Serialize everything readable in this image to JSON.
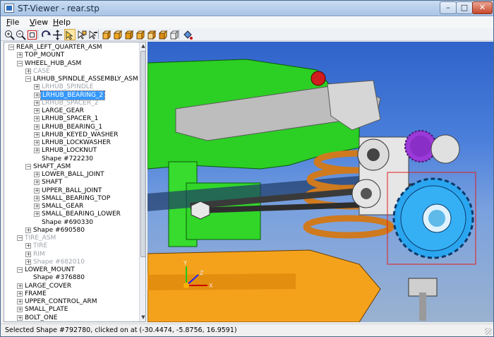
{
  "window": {
    "title": "ST-Viewer - rear.stp"
  },
  "menu": [
    {
      "label": "File",
      "key": "F",
      "rest": "ile"
    },
    {
      "label": "View",
      "key": "V",
      "rest": "iew"
    },
    {
      "label": "Help",
      "key": "H",
      "rest": "elp"
    }
  ],
  "toolbar": [
    {
      "name": "zoom-in-button",
      "icon": "zoom-in-icon"
    },
    {
      "name": "zoom-out-button",
      "icon": "zoom-out-icon"
    },
    {
      "name": "zoom-fit-button",
      "icon": "zoom-fit-icon"
    },
    {
      "name": "rotate-button",
      "icon": "rotate-icon"
    },
    {
      "name": "pan-button",
      "icon": "pan-icon"
    },
    {
      "name": "select-shape-button",
      "icon": "select-shape-icon",
      "active": true
    },
    {
      "name": "pick-face-button",
      "icon": "pick-face-icon"
    },
    {
      "name": "pick-edge-button",
      "icon": "pick-edge-icon"
    },
    {
      "name": "view-front-button",
      "icon": "cube-front-icon"
    },
    {
      "name": "view-back-button",
      "icon": "cube-back-icon"
    },
    {
      "name": "view-top-button",
      "icon": "cube-top-icon"
    },
    {
      "name": "view-bottom-button",
      "icon": "cube-bottom-icon"
    },
    {
      "name": "view-left-button",
      "icon": "cube-left-icon"
    },
    {
      "name": "view-right-button",
      "icon": "cube-right-icon"
    },
    {
      "name": "view-iso-button",
      "icon": "cube-iso-icon"
    },
    {
      "name": "shading-button",
      "icon": "paint-bucket-icon"
    }
  ],
  "tree": {
    "nodes": [
      {
        "label": "REAR_LEFT_QUARTER_ASM",
        "level": 0,
        "toggle": "-"
      },
      {
        "label": "TOP_MOUNT",
        "level": 1,
        "toggle": "+"
      },
      {
        "label": "WHEEL_HUB_ASM",
        "level": 1,
        "toggle": "-"
      },
      {
        "label": "CASE",
        "level": 2,
        "toggle": "+",
        "gray": true
      },
      {
        "label": "LRHUB_SPINDLE_ASSEMBLY_ASM",
        "level": 2,
        "toggle": "-"
      },
      {
        "label": "LRHUB_SPINDLE",
        "level": 3,
        "toggle": "+",
        "gray": true
      },
      {
        "label": "LRHUB_BEARING_2",
        "level": 3,
        "toggle": "+",
        "selected": true
      },
      {
        "label": "LRHUB_SPACER_2",
        "level": 3,
        "toggle": "+",
        "gray": true
      },
      {
        "label": "LARGE_GEAR",
        "level": 3,
        "toggle": "+"
      },
      {
        "label": "LRHUB_SPACER_1",
        "level": 3,
        "toggle": "+"
      },
      {
        "label": "LRHUB_BEARING_1",
        "level": 3,
        "toggle": "+"
      },
      {
        "label": "LRHUB_KEYED_WASHER",
        "level": 3,
        "toggle": "+"
      },
      {
        "label": "LRHUB_LOCKWASHER",
        "level": 3,
        "toggle": "+"
      },
      {
        "label": "LRHUB_LOCKNUT",
        "level": 3,
        "toggle": "+"
      },
      {
        "label": "Shape #722230",
        "level": 3,
        "toggle": ""
      },
      {
        "label": "SHAFT_ASM",
        "level": 2,
        "toggle": "-"
      },
      {
        "label": "LOWER_BALL_JOINT",
        "level": 3,
        "toggle": "+"
      },
      {
        "label": "SHAFT",
        "level": 3,
        "toggle": "+"
      },
      {
        "label": "UPPER_BALL_JOINT",
        "level": 3,
        "toggle": "+"
      },
      {
        "label": "SMALL_BEARING_TOP",
        "level": 3,
        "toggle": "+"
      },
      {
        "label": "SMALL_GEAR",
        "level": 3,
        "toggle": "+"
      },
      {
        "label": "SMALL_BEARING_LOWER",
        "level": 3,
        "toggle": "+"
      },
      {
        "label": "Shape #690330",
        "level": 3,
        "toggle": ""
      },
      {
        "label": "Shape #690580",
        "level": 2,
        "toggle": "+"
      },
      {
        "label": "TIRE_ASM",
        "level": 1,
        "toggle": "-",
        "gray": true
      },
      {
        "label": "TIRE",
        "level": 2,
        "toggle": "+",
        "gray": true
      },
      {
        "label": "RIM",
        "level": 2,
        "toggle": "+",
        "gray": true
      },
      {
        "label": "Shape #682010",
        "level": 2,
        "toggle": "+",
        "gray": true
      },
      {
        "label": "LOWER_MOUNT",
        "level": 1,
        "toggle": "-"
      },
      {
        "label": "Shape #376880",
        "level": 2,
        "toggle": ""
      },
      {
        "label": "LARGE_COVER",
        "level": 1,
        "toggle": "+"
      },
      {
        "label": "FRAME",
        "level": 1,
        "toggle": "+"
      },
      {
        "label": "UPPER_CONTROL_ARM",
        "level": 1,
        "toggle": "+"
      },
      {
        "label": "SMALL_PLATE",
        "level": 1,
        "toggle": "+"
      },
      {
        "label": "BOLT_ONE",
        "level": 1,
        "toggle": "+"
      }
    ]
  },
  "viewport": {
    "axis_labels": {
      "x": "X",
      "y": "Y",
      "z": "Z"
    },
    "colors": {
      "frame": "#34e02c",
      "gear_highlight": "#2aa6f0",
      "small_gear": "#9b3ad8",
      "spring": "#d1781e",
      "lower_arm": "#f4a21c",
      "metal": "#c8c8c8",
      "selection_box": "#e02020"
    }
  },
  "status": {
    "text": "Selected Shape #792780, clicked on at (-30.4474, -5.8756, 16.9591)"
  }
}
